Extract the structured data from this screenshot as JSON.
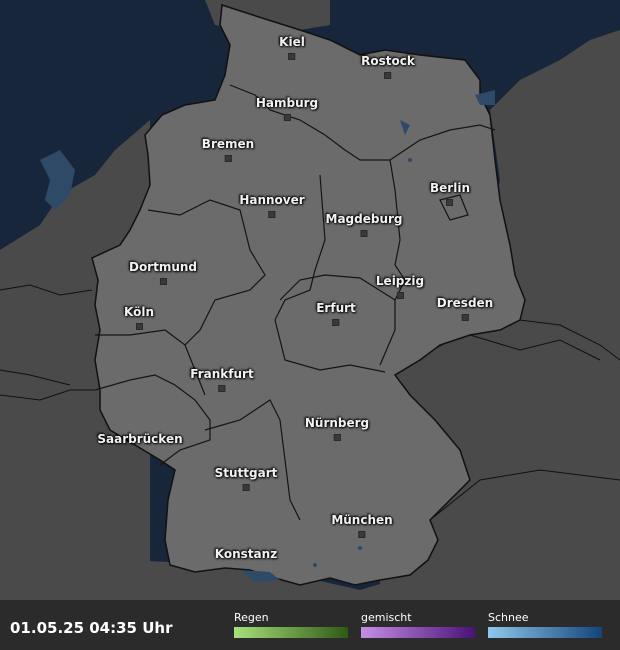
{
  "map": {
    "cities": [
      {
        "id": "kiel",
        "label": "Kiel"
      },
      {
        "id": "rostock",
        "label": "Rostock"
      },
      {
        "id": "hamburg",
        "label": "Hamburg"
      },
      {
        "id": "bremen",
        "label": "Bremen"
      },
      {
        "id": "berlin",
        "label": "Berlin"
      },
      {
        "id": "hannover",
        "label": "Hannover"
      },
      {
        "id": "magdeburg",
        "label": "Magdeburg"
      },
      {
        "id": "dortmund",
        "label": "Dortmund"
      },
      {
        "id": "leipzig",
        "label": "Leipzig"
      },
      {
        "id": "koeln",
        "label": "Köln"
      },
      {
        "id": "erfurt",
        "label": "Erfurt"
      },
      {
        "id": "dresden",
        "label": "Dresden"
      },
      {
        "id": "frankfurt",
        "label": "Frankfurt"
      },
      {
        "id": "saarbruecken",
        "label": "Saarbrücken"
      },
      {
        "id": "nuernberg",
        "label": "Nürnberg"
      },
      {
        "id": "stuttgart",
        "label": "Stuttgart"
      },
      {
        "id": "muenchen",
        "label": "München"
      },
      {
        "id": "konstanz",
        "label": "Konstanz"
      }
    ],
    "colors": {
      "sea": "#17263a",
      "germany": "#6b6b6b",
      "neighbors": "#4a4a4a",
      "borders": "#111111",
      "water": "#2f4a66"
    }
  },
  "footer": {
    "timestamp": "01.05.25 04:35 Uhr",
    "legend": {
      "rain": {
        "label": "Regen",
        "colors": [
          "#a8e07a",
          "#2f5a16"
        ]
      },
      "mixed": {
        "label": "gemischt",
        "colors": [
          "#c58ee6",
          "#4a1276"
        ]
      },
      "snow": {
        "label": "Schnee",
        "colors": [
          "#8fc8ec",
          "#14457a"
        ]
      }
    }
  }
}
